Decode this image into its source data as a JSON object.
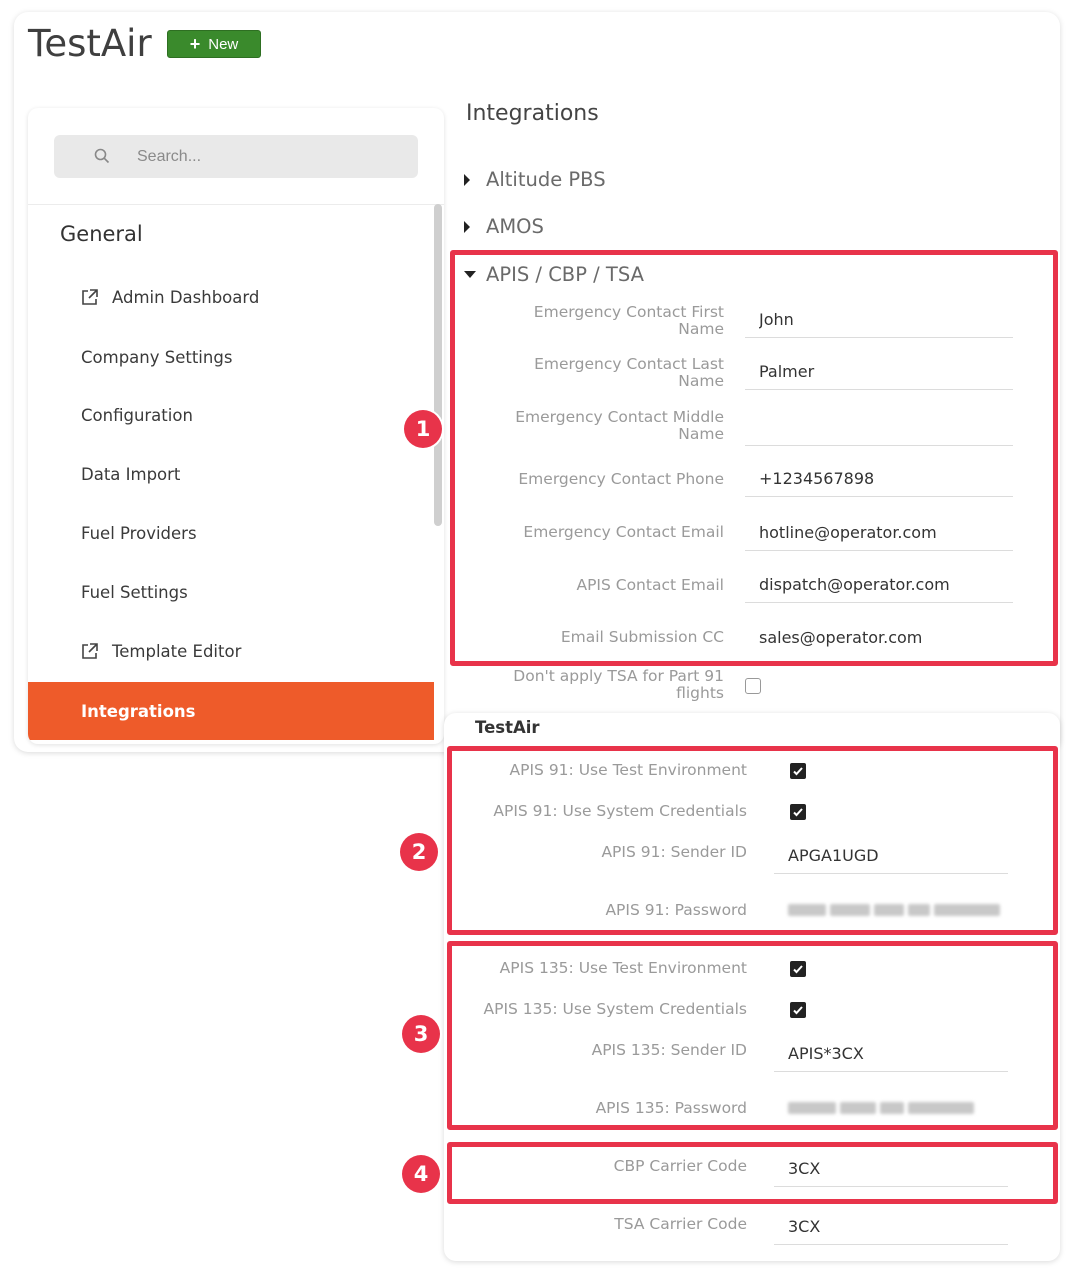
{
  "app": {
    "title": "TestAir",
    "new_button_label": "New"
  },
  "sidebar": {
    "search_placeholder": "Search...",
    "section_heading": "General",
    "items": [
      {
        "label": "Admin Dashboard",
        "icon": "external-link-icon"
      },
      {
        "label": "Company Settings"
      },
      {
        "label": "Configuration"
      },
      {
        "label": "Data Import"
      },
      {
        "label": "Fuel Providers"
      },
      {
        "label": "Fuel Settings"
      },
      {
        "label": "Template Editor",
        "icon": "external-link-icon"
      },
      {
        "label": "Integrations",
        "active": true
      }
    ]
  },
  "main": {
    "title": "Integrations",
    "accordions": [
      {
        "label": "Altitude PBS",
        "expanded": false
      },
      {
        "label": "AMOS",
        "expanded": false
      },
      {
        "label": "APIS / CBP / TSA",
        "expanded": true
      }
    ],
    "apis_fields": [
      {
        "label_line1": "Emergency Contact First",
        "label_line2": "Name",
        "value": "John"
      },
      {
        "label_line1": "Emergency Contact Last",
        "label_line2": "Name",
        "value": "Palmer"
      },
      {
        "label_line1": "Emergency Contact Middle",
        "label_line2": "Name",
        "value": ""
      },
      {
        "label_line1": "Emergency Contact Phone",
        "value": "+1234567898"
      },
      {
        "label_line1": "Emergency Contact Email",
        "value": "hotline@operator.com"
      },
      {
        "label_line1": "APIS Contact Email",
        "value": "dispatch@operator.com"
      },
      {
        "label_line1": "Email Submission CC",
        "value": "sales@operator.com"
      }
    ],
    "tsa_part91": {
      "label_line1": "Don't apply TSA for Part 91",
      "label_line2": "flights",
      "checked": false
    },
    "operator_section": {
      "heading": "TestAir",
      "apis91": {
        "test_env_label": "APIS 91: Use Test Environment",
        "test_env_checked": true,
        "sys_cred_label": "APIS 91: Use System Credentials",
        "sys_cred_checked": true,
        "sender_label": "APIS 91: Sender ID",
        "sender_value": "APGA1UGD",
        "password_label": "APIS 91: Password"
      },
      "apis135": {
        "test_env_label": "APIS 135: Use Test Environment",
        "test_env_checked": true,
        "sys_cred_label": "APIS 135: Use System Credentials",
        "sys_cred_checked": true,
        "sender_label": "APIS 135: Sender ID",
        "sender_value": "APIS*3CX",
        "password_label": "APIS 135: Password"
      },
      "cbp_label": "CBP Carrier Code",
      "cbp_value": "3CX",
      "tsa_label": "TSA Carrier Code",
      "tsa_value": "3CX"
    }
  },
  "annotations": {
    "badge_1": "1",
    "badge_2": "2",
    "badge_3": "3",
    "badge_4": "4",
    "color": "#e8334a"
  },
  "colors": {
    "brand_green": "#3a8a2c",
    "active_orange": "#ee5b2a"
  }
}
